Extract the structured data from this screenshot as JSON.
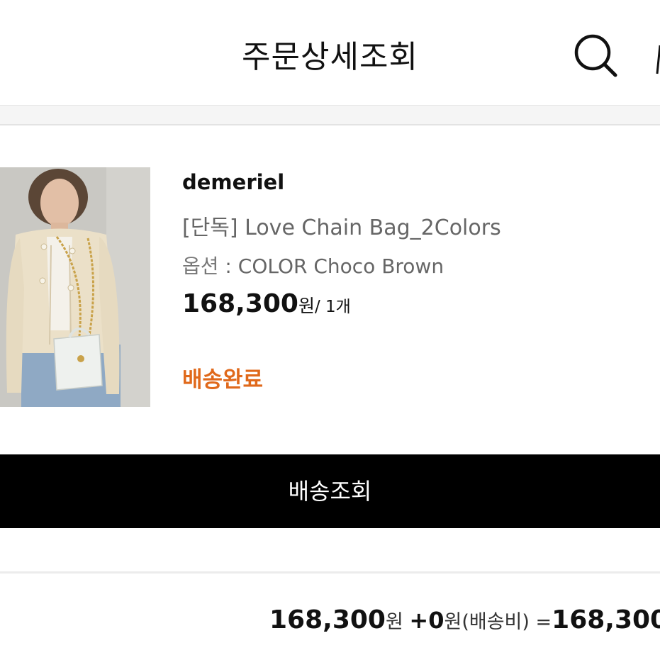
{
  "header": {
    "title": "주문상세조회",
    "search_icon": "search-icon"
  },
  "order_item": {
    "brand": "demeriel",
    "product_name": "[단독] Love Chain Bag_2Colors",
    "option_label": "옵션",
    "option_separator": " : ",
    "option_value": "COLOR Choco Brown",
    "price": "168,300",
    "price_unit": "원",
    "quantity_text": "/ 1개",
    "status": "배송완료",
    "status_color": "#e0691b",
    "thumbnail_icon": "product-photo"
  },
  "actions": {
    "track_delivery": "배송조회"
  },
  "summary": {
    "product_total": "168,300",
    "product_total_unit": "원",
    "shipping_plus": "+0",
    "shipping_unit_label": "원(배송비)",
    "equals": "=",
    "grand_total": "168,300"
  },
  "colors": {
    "accent": "#e0691b",
    "button_bg": "#000000",
    "divider": "#ececec"
  }
}
